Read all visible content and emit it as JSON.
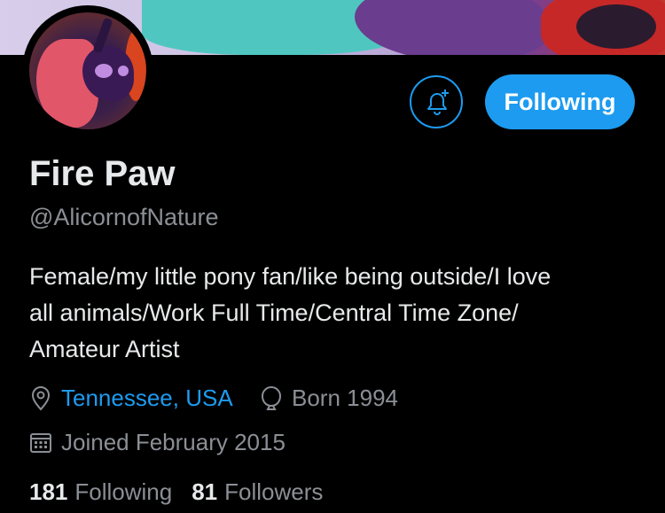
{
  "header": {
    "banner_colors": [
      "#d8cdea",
      "#4fc7c0",
      "#6b3d8e",
      "#c62828"
    ]
  },
  "profile": {
    "name": "Fire Paw",
    "handle": "@AlicornofNature",
    "bio_lines": [
      "Female/my little pony fan/like being outside/I love",
      "all animals/Work Full Time/Central Time Zone/",
      "Amateur Artist"
    ],
    "location": "Tennessee, USA",
    "born": "Born 1994",
    "joined": "Joined February 2015"
  },
  "actions": {
    "notify_icon": "bell-plus-icon",
    "follow_label": "Following"
  },
  "stats": {
    "following_count": "181",
    "following_label": "Following",
    "followers_count": "81",
    "followers_label": "Followers"
  },
  "colors": {
    "accent": "#1d9bf0",
    "muted": "#8b8f95",
    "text": "#e7e9ea",
    "background": "#000000"
  }
}
